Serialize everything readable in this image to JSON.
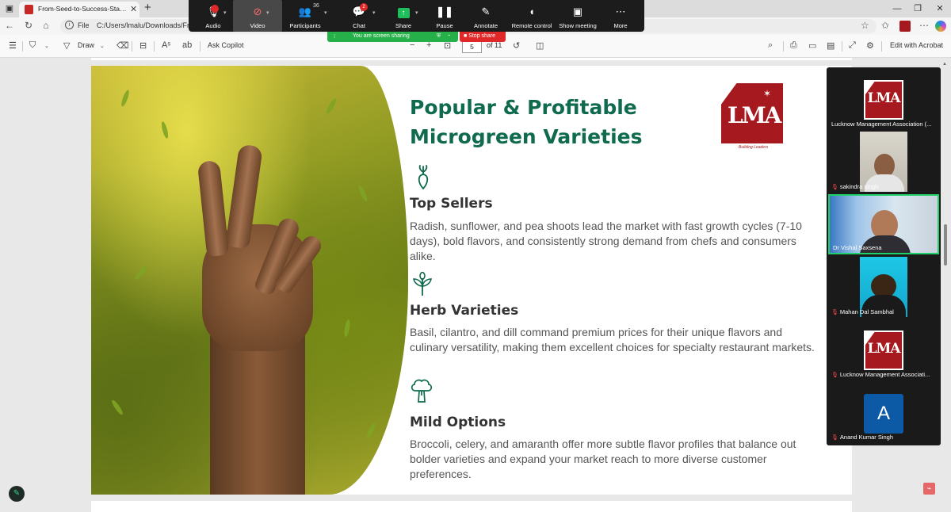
{
  "browser": {
    "tab_title": "From-Seed-to-Success-Starting-Y",
    "address_scheme": "File",
    "address_url": "C:/Users/lmalu/Downloads/From"
  },
  "zoom": {
    "controls": [
      {
        "label": "Audio",
        "icon": "microphone-muted-icon"
      },
      {
        "label": "Video",
        "icon": "video-off-icon"
      },
      {
        "label": "Participants",
        "icon": "participants-icon",
        "count": "36"
      },
      {
        "label": "Chat",
        "icon": "chat-icon",
        "badge": "2"
      },
      {
        "label": "Share",
        "icon": "share-screen-icon"
      },
      {
        "label": "Pause",
        "icon": "pause-icon"
      },
      {
        "label": "Annotate",
        "icon": "pen-icon"
      },
      {
        "label": "Remote control",
        "icon": "mouse-icon"
      },
      {
        "label": "Show meeting",
        "icon": "monitor-icon"
      },
      {
        "label": "More",
        "icon": "more-icon"
      }
    ],
    "sharing_banner": "You are screen sharing",
    "stop_share": "Stop share",
    "accent_green": "#26b04a",
    "stop_red": "#e02828"
  },
  "pdf_toolbar": {
    "draw_label": "Draw",
    "ask_copilot": "Ask Copilot",
    "page_current": "5",
    "page_total": "of 11",
    "edit_acrobat": "Edit with Acrobat"
  },
  "slide": {
    "title": "Popular & Profitable Microgreen Varieties",
    "logo_text": "LMA",
    "logo_tagline": "Building Leaders",
    "title_color": "#0f6a4e",
    "logo_color": "#a6191e",
    "sections": [
      {
        "icon": "radish-icon",
        "heading": "Top Sellers",
        "body": "Radish, sunflower, and pea shoots lead the market with fast growth cycles (7-10 days), bold flavors, and consistently strong demand from chefs and consumers alike."
      },
      {
        "icon": "herb-icon",
        "heading": "Herb Varieties",
        "body": "Basil, cilantro, and dill command premium prices for their unique flavors and culinary versatility, making them excellent choices for specialty restaurant markets."
      },
      {
        "icon": "broccoli-icon",
        "heading": "Mild Options",
        "body": "Broccoli, celery, and amaranth offer more subtle flavor profiles that balance out bolder varieties and expand your market reach to more diverse customer preferences."
      }
    ]
  },
  "participants": [
    {
      "name": "Lucknow Management Association (...",
      "type": "logo",
      "logo_text": "LMA",
      "muted": false
    },
    {
      "name": "sakindra singh",
      "type": "video",
      "muted": true
    },
    {
      "name": "Dr Vishal Saxsena",
      "type": "video",
      "muted": false,
      "active": true
    },
    {
      "name": "Mahan Dal Sambhal",
      "type": "video",
      "muted": true
    },
    {
      "name": "Lucknow Management Associati...",
      "type": "logo",
      "logo_text": "LMA",
      "muted": true
    },
    {
      "name": "Anand Kumar Singh",
      "type": "avatar",
      "initial": "A",
      "muted": true
    }
  ]
}
